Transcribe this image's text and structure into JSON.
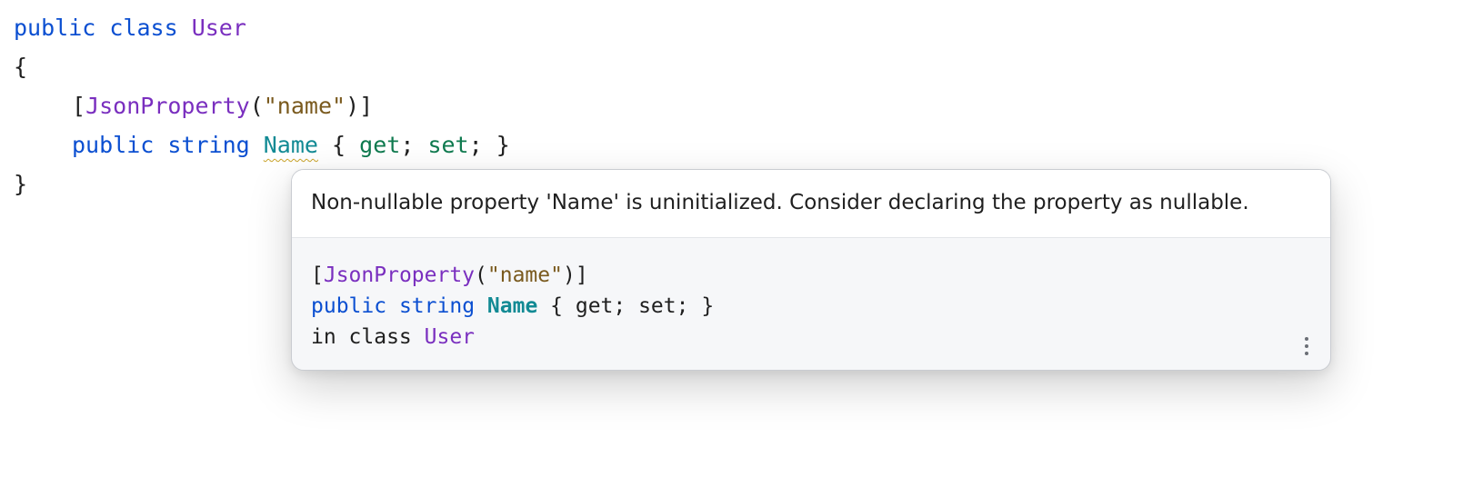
{
  "editor": {
    "line1": {
      "kw_public": "public",
      "kw_class": "class",
      "class_name": "User"
    },
    "line2": {
      "brace_open": "{"
    },
    "line3": {
      "bracket_open": "[",
      "attribute": "JsonProperty",
      "paren_open": "(",
      "string": "\"name\"",
      "paren_close": ")",
      "bracket_close": "]"
    },
    "line4": {
      "kw_public": "public",
      "kw_string": "string",
      "prop_name": "Name",
      "brace_open": "{",
      "get": "get",
      "semi1": ";",
      "set": "set",
      "semi2": ";",
      "brace_close": "}"
    },
    "line5": {
      "brace_close": "}"
    }
  },
  "popup": {
    "message": "Non-nullable property 'Name' is uninitialized. Consider declaring the property as nullable.",
    "line1": {
      "bracket_open": "[",
      "attribute": "JsonProperty",
      "paren_open": "(",
      "string": "\"name\"",
      "paren_close": ")",
      "bracket_close": "]"
    },
    "line2": {
      "kw_public": "public",
      "kw_string": "string",
      "prop_name": "Name",
      "rest": "{ get; set; }"
    },
    "line3": {
      "prefix": "in class",
      "class_name": "User"
    },
    "more_icon": "more-vertical-icon"
  },
  "colors": {
    "keyword": "#0b4fd1",
    "class": "#7a2fbf",
    "string": "#7a5a1e",
    "accessor": "#0f7a4f",
    "property": "#128a94",
    "warning_squiggle": "#c9a227"
  }
}
